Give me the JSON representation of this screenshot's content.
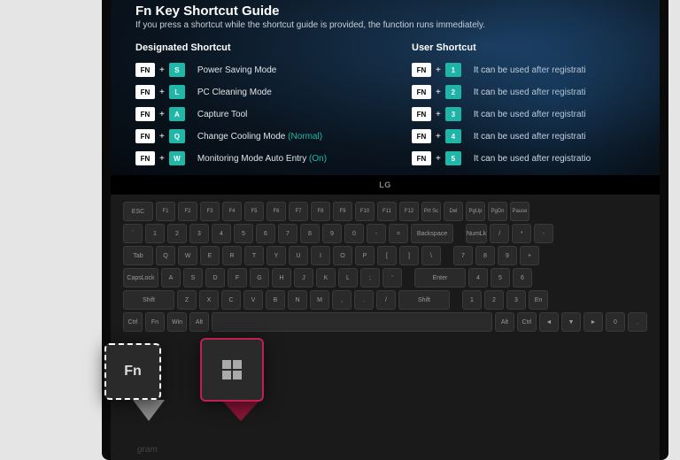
{
  "guide": {
    "title": "Fn Key Shortcut Guide",
    "subtitle": "If you press a shortcut while the shortcut guide is provided, the function runs immediately."
  },
  "designated": {
    "title": "Designated Shortcut",
    "fn_label": "FN",
    "items": [
      {
        "key": "S",
        "desc": "Power Saving Mode",
        "status": ""
      },
      {
        "key": "L",
        "desc": "PC Cleaning Mode",
        "status": ""
      },
      {
        "key": "A",
        "desc": "Capture Tool",
        "status": ""
      },
      {
        "key": "Q",
        "desc": "Change Cooling Mode ",
        "status": "(Normal)"
      },
      {
        "key": "W",
        "desc": "Monitoring Mode Auto Entry ",
        "status": "(On)"
      }
    ]
  },
  "user": {
    "title": "User Shortcut",
    "fn_label": "FN",
    "items": [
      {
        "key": "1",
        "desc": "It can be used after registrati"
      },
      {
        "key": "2",
        "desc": "It can be used after registrati"
      },
      {
        "key": "3",
        "desc": "It can be used after registrati"
      },
      {
        "key": "4",
        "desc": "It can be used after registrati"
      },
      {
        "key": "5",
        "desc": "It can be used after registratio"
      }
    ]
  },
  "logo": "LG",
  "gram": "gram",
  "popup": {
    "fn": "Fn"
  },
  "krows": {
    "r0": [
      "ESC",
      "F1",
      "F2",
      "F3",
      "F4",
      "F5",
      "F6",
      "F7",
      "F8",
      "F9",
      "F10",
      "F11",
      "F12",
      "Prt Sc",
      "Del",
      "PgUp",
      "PgDn",
      "Pause"
    ],
    "r1": [
      "`",
      "1",
      "2",
      "3",
      "4",
      "5",
      "6",
      "7",
      "8",
      "9",
      "0",
      "-",
      "=",
      "Backspace",
      "NumLk",
      "/",
      "*",
      "-"
    ],
    "r2": [
      "Tab",
      "Q",
      "W",
      "E",
      "R",
      "T",
      "Y",
      "U",
      "I",
      "O",
      "P",
      "[",
      "]",
      "\\",
      "7",
      "8",
      "9",
      "+"
    ],
    "r3": [
      "CapsLock",
      "A",
      "S",
      "D",
      "F",
      "G",
      "H",
      "J",
      "K",
      "L",
      ";",
      "'",
      "Enter",
      "4",
      "5",
      "6"
    ],
    "r4": [
      "Shift",
      "Z",
      "X",
      "C",
      "V",
      "B",
      "N",
      "M",
      ",",
      ".",
      "/",
      "Shift",
      "1",
      "2",
      "3",
      "En"
    ],
    "r5": [
      "Ctrl",
      "Fn",
      "Win",
      "Alt",
      "",
      "Alt",
      "Ctrl",
      "◄",
      "▼",
      "►",
      "0",
      "."
    ]
  }
}
